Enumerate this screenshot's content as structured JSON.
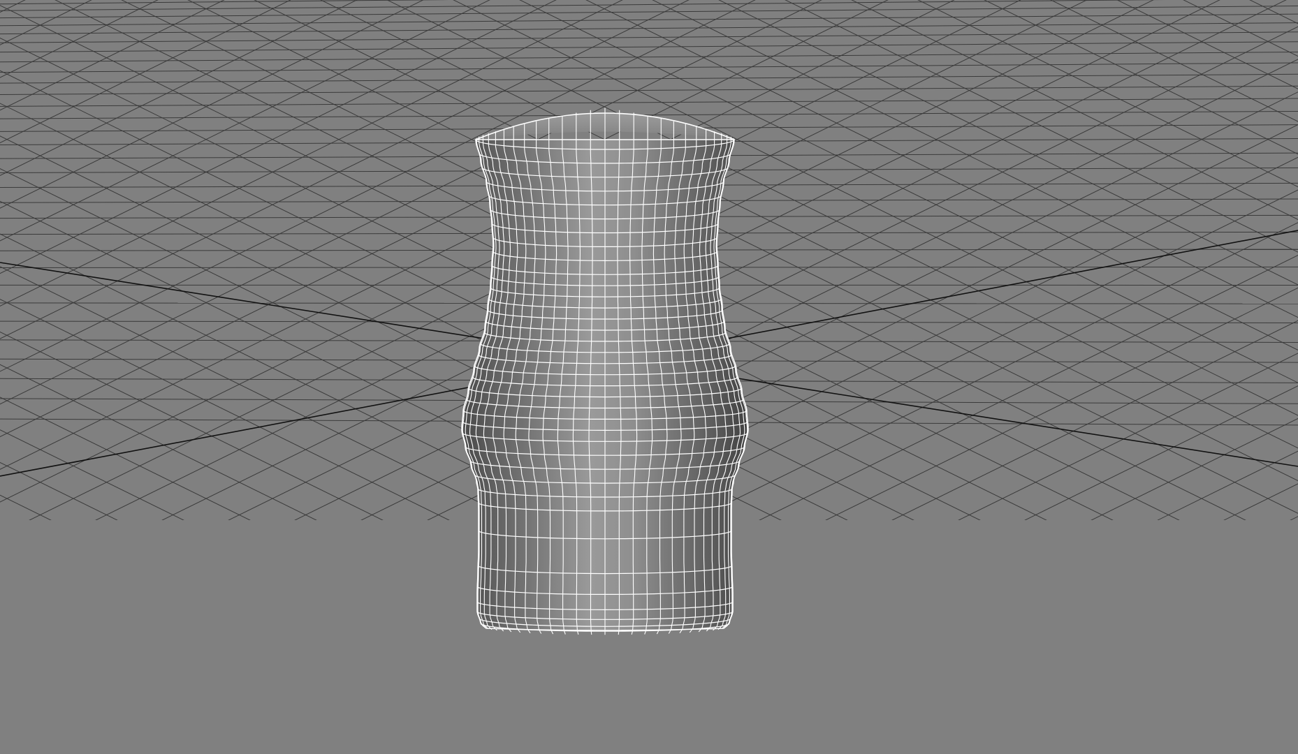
{
  "viewport": {
    "background_color": "#808080",
    "grid_line_color": "#3a3a3a",
    "grid_axis_color": "#111111",
    "wireframe_color": "#ffffff",
    "mesh_shading": [
      "#9a9a9a",
      "#7c7c7c",
      "#4a4a4a"
    ],
    "object": "vase-mesh"
  }
}
